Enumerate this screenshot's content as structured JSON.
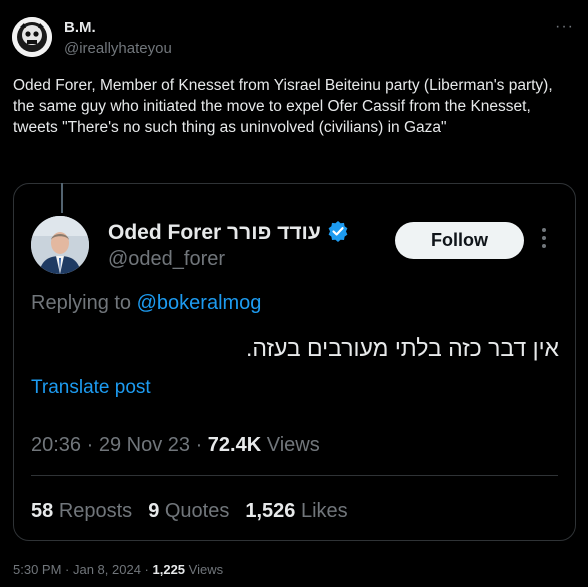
{
  "author": {
    "name": "B.M.",
    "handle": "@ireallyhateyou"
  },
  "tweet": {
    "text": "Oded Forer, Member of Knesset from Yisrael Beiteinu party (Liberman's party), the same guy who initiated the move to expel Ofer Cassif from the Knesset, tweets \"There's no such thing as uninvolved (civilians) in Gaza\""
  },
  "quoted": {
    "name": "Oded Forer עודד פורר",
    "handle": "@oded_forer",
    "follow_label": "Follow",
    "replying_prefix": "Replying to ",
    "replying_to": "@bokeralmog",
    "text": "אין דבר כזה בלתי מעורבים בעזה.",
    "translate_label": "Translate post",
    "time": "20:36",
    "date": "29 Nov 23",
    "views_count": "72.4K",
    "views_label": "Views",
    "reposts_count": "58",
    "reposts_label": "Reposts",
    "quotes_count": "9",
    "quotes_label": "Quotes",
    "likes_count": "1,526",
    "likes_label": "Likes"
  },
  "footer": {
    "time": "5:30 PM",
    "date": "Jan 8, 2024",
    "views_count": "1,225",
    "views_label": "Views"
  },
  "icons": {
    "more": "more-horizontal-icon",
    "verified": "verified-badge-icon"
  },
  "colors": {
    "background": "#000000",
    "text": "#e7e9ea",
    "muted": "#71767b",
    "link": "#1d9bf0"
  }
}
